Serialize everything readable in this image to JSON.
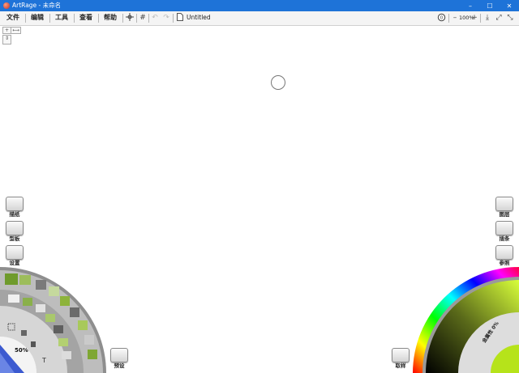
{
  "titlebar": {
    "title": "ArtRage - 未命名",
    "minimize": "–",
    "maximize": "☐",
    "close": "✕"
  },
  "menu": {
    "file": "文件",
    "edit": "编辑",
    "tools": "工具",
    "view": "查看",
    "help": "帮助"
  },
  "toolbar": {
    "document_title": "Untitled",
    "zoom": "100%",
    "zoom_minus": "–",
    "zoom_plus": "+"
  },
  "left_panel": {
    "tracing_label": "描纸",
    "stencil_label": "型板",
    "settings_label": "设置",
    "preset_label": "预设",
    "brush_size": "50%"
  },
  "right_panel": {
    "layers_label": "图层",
    "sticker_label": "插条",
    "reference_label": "参照",
    "swatch_label": "取样",
    "metallic_label": "金属性 0%"
  },
  "colors": {
    "titlebar": "#1e73d8",
    "accent_green": "#b6e31a"
  }
}
